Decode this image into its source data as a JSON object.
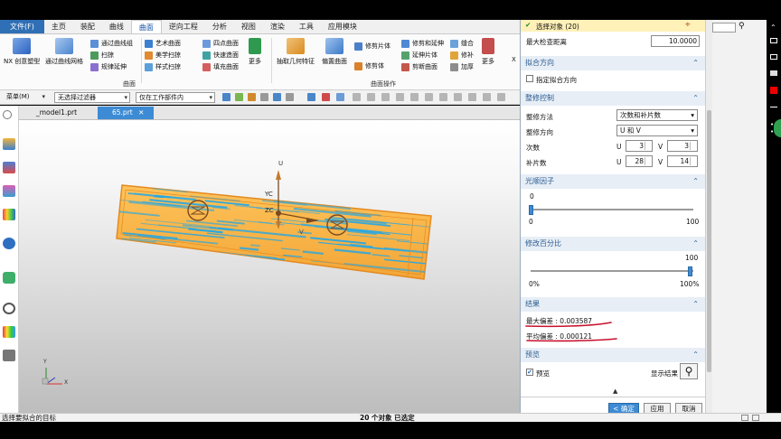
{
  "ribbon": {
    "file_tab": "文件(F)",
    "tabs": [
      "主页",
      "装配",
      "曲线",
      "曲面",
      "逆向工程",
      "分析",
      "视图",
      "渲染",
      "工具",
      "应用模块"
    ],
    "active_tab": "曲面",
    "buttons": {
      "nx_create": "NX 创意塑型",
      "through_curve_mesh": "通过曲线网格",
      "through_curves": "通过曲线组",
      "sweep": "扫掠",
      "law_extension": "规律延伸",
      "studio_surface": "艺术曲面",
      "styled_sweep": "美学扫掠",
      "styled_blend": "样式扫掠",
      "four_point": "四点曲面",
      "quick_surface": "快速造面",
      "fill_surface": "填充曲面",
      "more1": "更多",
      "extract_geometry": "抽取几何特征",
      "offset_surface": "偏置曲面",
      "trim_sheet": "修剪片体",
      "trim_extend": "修剪和延伸",
      "extend_sheet": "延伸片体",
      "trimmed_surface": "剪断曲面",
      "trim_body": "修剪体",
      "sew": "缝合",
      "patch": "修补",
      "thicken": "加厚",
      "more2": "更多",
      "x_label": "X"
    },
    "group_surface": "曲面",
    "group_surface_ops": "曲面操作"
  },
  "toolbar": {
    "menu": "菜单(M)",
    "filter": "无选择过滤器",
    "scope": "仅在工作部件内"
  },
  "file_tabs": [
    "_model1.prt",
    "65.prt"
  ],
  "viewport": {
    "axis_u": "U",
    "axis_yc": "YC",
    "axis_zc": "ZC",
    "axis_v": "V",
    "triad_y": "Y",
    "triad_x": "X"
  },
  "dialog": {
    "select_object": "选择对象 (20)",
    "max_check_distance_label": "最大检查距离",
    "max_check_distance_value": "10.0000",
    "section_fit_direction": "拟合方向",
    "specify_fit_direction": "指定拟合方向",
    "section_refine": "整修控制",
    "refine_method_label": "整修方法",
    "refine_method_value": "次数和补片数",
    "refine_direction_label": "整修方向",
    "refine_direction_value": "U 和 V",
    "degree_label": "次数",
    "patches_label": "补片数",
    "u_label": "U",
    "v_label": "V",
    "degree_u": "3",
    "degree_v": "3",
    "patches_u": "28",
    "patches_v": "14",
    "section_smooth": "光顺因子",
    "smooth_value_text": "0",
    "smooth_fraction": 0,
    "smooth_min": "0",
    "smooth_max": "100",
    "section_modify": "修改百分比",
    "modify_value_text": "100",
    "modify_fraction": 1,
    "modify_min": "0%",
    "modify_max": "100%",
    "section_result": "结果",
    "max_deviation": "最大偏差 : 0.003587",
    "avg_deviation": "平均偏差 : 0.000121",
    "section_preview": "预览",
    "preview_label": "预览",
    "show_result": "显示结果",
    "ok": "< 确定 >",
    "apply": "应用",
    "cancel": "取消"
  },
  "status": {
    "left": "选择要拟合的目标",
    "center": "20 个对象 已选定"
  },
  "colors": {
    "accent": "#3c8bd4",
    "surface_orange": "#ffb23f",
    "surface_blue": "#2aa7e0",
    "underline_red": "#c8102e"
  }
}
